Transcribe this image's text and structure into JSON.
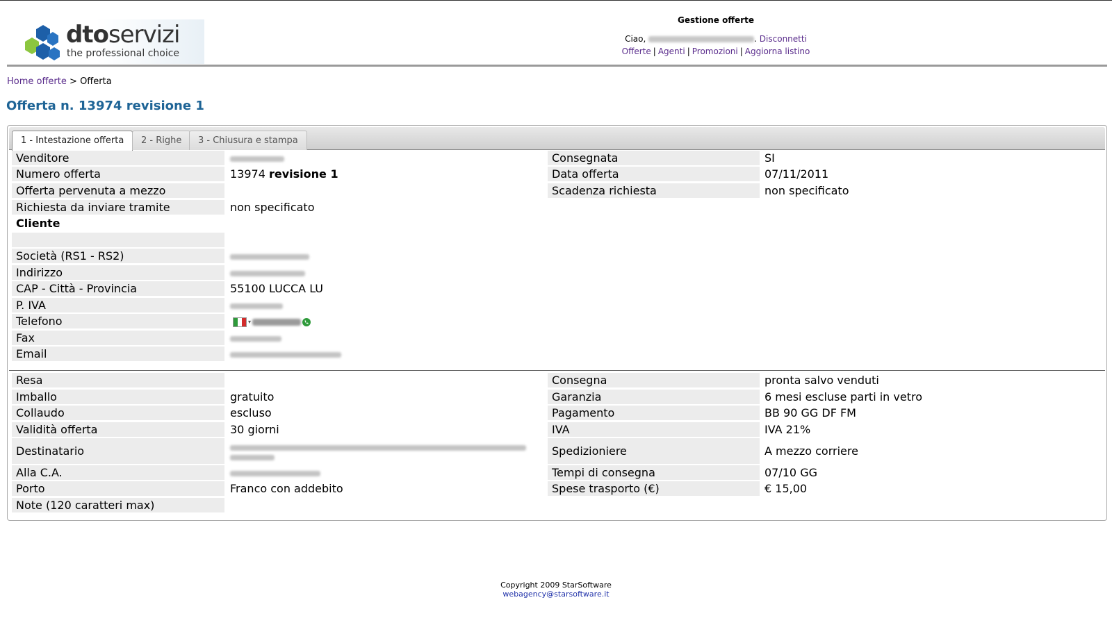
{
  "header": {
    "app_title": "Gestione offerte",
    "greeting": "Ciao,",
    "logout": "Disconnetti",
    "nav": [
      "Offerte",
      "Agenti",
      "Promozioni",
      "Aggiorna listino"
    ],
    "logo_word_bold": "dto",
    "logo_word_rest": "servizi",
    "logo_tagline": "the professional choice"
  },
  "breadcrumb": {
    "home": "Home offerte",
    "sep": ">",
    "current": "Offerta"
  },
  "page_title": "Offerta n. 13974 revisione 1",
  "tabs": [
    "1 - Intestazione offerta",
    "2 - Righe",
    "3 - Chiusura e stampa"
  ],
  "section1_left": {
    "venditore": "Venditore",
    "numero_offerta": "Numero offerta",
    "numero_value": "13974",
    "revisione_value": "revisione 1",
    "pervenuta": "Offerta pervenuta a mezzo",
    "richiesta": "Richiesta da inviare tramite",
    "richiesta_value": "non specificato",
    "cliente": "Cliente",
    "societa": "Società (RS1 - RS2)",
    "indirizzo": "Indirizzo",
    "cap": "CAP - Città - Provincia",
    "cap_value": "55100 LUCCA LU",
    "piva": "P. IVA",
    "telefono": "Telefono",
    "fax": "Fax",
    "email": "Email"
  },
  "section1_right": {
    "consegnata": "Consegnata",
    "consegnata_value": "SI",
    "data_offerta": "Data offerta",
    "data_offerta_value": "07/11/2011",
    "scadenza": "Scadenza richiesta",
    "scadenza_value": "non specificato"
  },
  "section2_left": {
    "resa": "Resa",
    "imballo": "Imballo",
    "imballo_value": "gratuito",
    "collaudo": "Collaudo",
    "collaudo_value": "escluso",
    "validita": "Validità offerta",
    "validita_value": "30 giorni",
    "destinatario": "Destinatario",
    "alla_ca": "Alla C.A.",
    "porto": "Porto",
    "porto_value": "Franco con addebito",
    "note": "Note (120 caratteri max)"
  },
  "section2_right": {
    "consegna": "Consegna",
    "consegna_value": "pronta salvo venduti",
    "garanzia": "Garanzia",
    "garanzia_value": "6 mesi escluse parti in vetro",
    "pagamento": "Pagamento",
    "pagamento_value": "BB 90 GG DF FM",
    "iva": "IVA",
    "iva_value": "IVA 21%",
    "spedizioniere": "Spedizioniere",
    "spedizioniere_value": "A mezzo corriere",
    "tempi": "Tempi di consegna",
    "tempi_value": "07/10 GG",
    "spese": "Spese trasporto (€)",
    "spese_value": "€ 15,00"
  },
  "footer": {
    "copyright": "Copyright 2009 StarSoftware",
    "email": "webagency@starsoftware.it"
  },
  "colors": {
    "title_blue": "#1e6496",
    "link_purple": "#5a2c8c",
    "label_bg": "#ececec"
  }
}
